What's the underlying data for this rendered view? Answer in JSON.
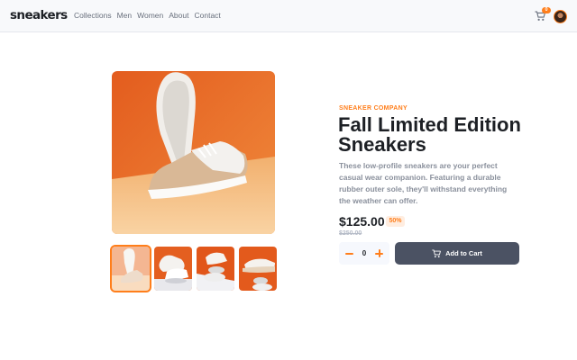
{
  "header": {
    "logo": "sneakers",
    "nav": [
      "Collections",
      "Men",
      "Women",
      "About",
      "Contact"
    ],
    "cart_count": "0"
  },
  "product": {
    "company": "SNEAKER COMPANY",
    "title": "Fall Limited Edition Sneakers",
    "description": "These low-profile sneakers are your perfect casual wear companion. Featuring a durable rubber outer sole, they'll withstand everything the weather can offer.",
    "price": "$125.00",
    "discount": "50%",
    "old_price": "$250.00",
    "quantity": "0",
    "add_to_cart_label": "Add to Cart"
  },
  "gallery": {
    "active_thumbnail": 1,
    "thumbnail_count": 4
  },
  "colors": {
    "accent": "#ff7e1b",
    "dark_button": "#4b5263",
    "text_dark": "#1d2025",
    "text_muted": "#8a909c"
  },
  "icons": [
    "cart-icon",
    "avatar",
    "minus-icon",
    "plus-icon"
  ]
}
